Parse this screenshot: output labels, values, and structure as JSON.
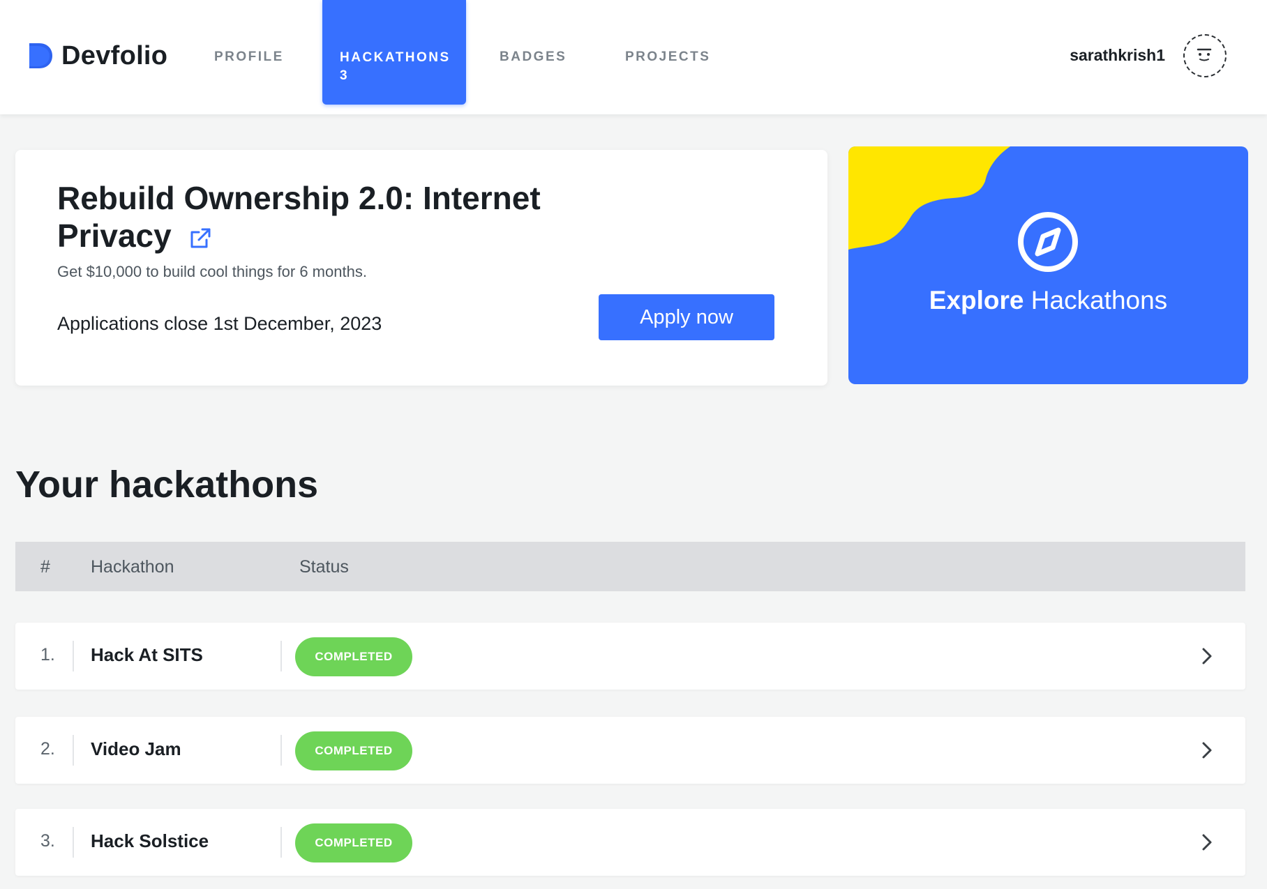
{
  "brand": {
    "name": "Devfolio",
    "logo_color": "#3770ff"
  },
  "nav": {
    "profile": "PROFILE",
    "hackathons": "HACKATHONS",
    "hackathons_count": "3",
    "badges": "BADGES",
    "projects": "PROJECTS",
    "active": "HACKATHONS"
  },
  "user": {
    "username": "sarathkrish1",
    "avatar_icon": "avatar-face-icon"
  },
  "promo": {
    "title": "Rebuild Ownership 2.0: Internet Privacy",
    "title_icon": "external-link-icon",
    "subtitle": "Get $10,000 to build cool things for 6 months.",
    "deadline": "Applications close 1st December, 2023",
    "cta": "Apply now"
  },
  "explore": {
    "bold": "Explore",
    "rest": "Hackathons",
    "icon": "compass-icon",
    "bg_color": "#3770ff",
    "accent_color": "#ffe600"
  },
  "section": {
    "title": "Your hackathons"
  },
  "table": {
    "headers": {
      "num": "#",
      "name": "Hackathon",
      "status": "Status"
    },
    "rows": [
      {
        "num": "1.",
        "name": "Hack At SITS",
        "status": "COMPLETED"
      },
      {
        "num": "2.",
        "name": "Video Jam",
        "status": "COMPLETED"
      },
      {
        "num": "3.",
        "name": "Hack Solstice",
        "status": "COMPLETED"
      }
    ],
    "status_color": "#6ed457"
  }
}
